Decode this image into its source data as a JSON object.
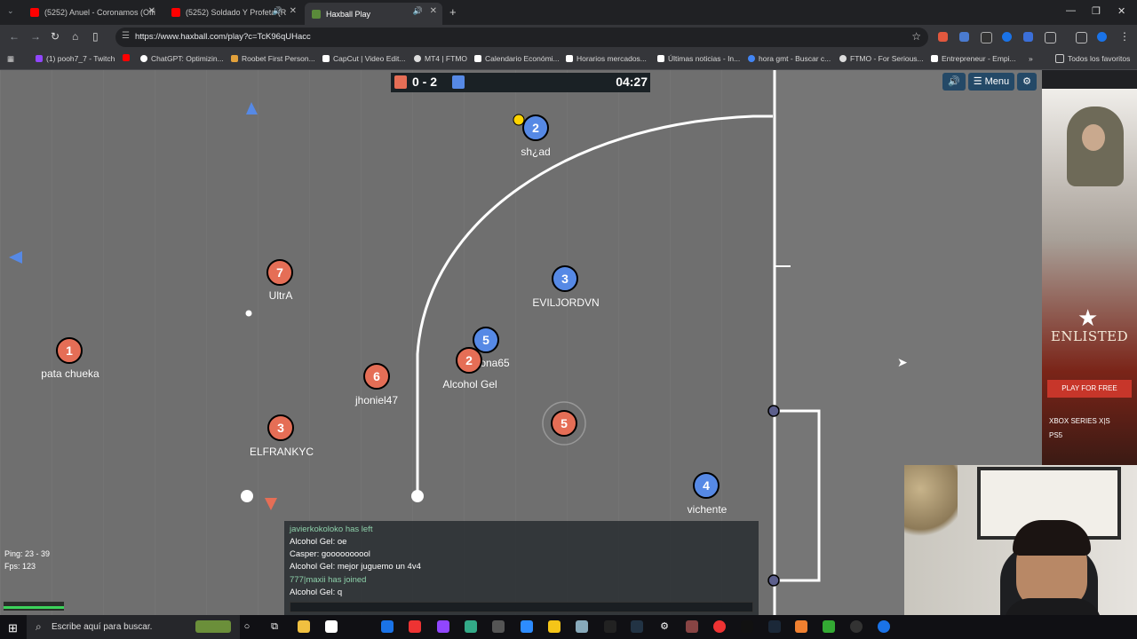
{
  "tabs": [
    {
      "title": "(5252) Anuel - Coronamos (Offi",
      "color": "#ff0000"
    },
    {
      "title": "(5252) Soldado Y Profeta (R",
      "color": "#ff0000"
    },
    {
      "title": "Haxball Play",
      "color": "#5a8a3a"
    }
  ],
  "omnibox": {
    "url": "https://www.haxball.com/play?c=TcK96qUHacc"
  },
  "bookmarks": [
    {
      "label": "(1) pooh7_7 - Twitch",
      "color": "#9146ff"
    },
    {
      "label": "",
      "color": "#ff0000"
    },
    {
      "label": "ChatGPT: Optimizin...",
      "color": "#ffffff"
    },
    {
      "label": "Roobet First Person...",
      "color": "#e2a13b"
    },
    {
      "label": "CapCut | Video Edit...",
      "color": "#ffffff"
    },
    {
      "label": "MT4 | FTMO",
      "color": "#dddddd"
    },
    {
      "label": "Calendario Económi...",
      "color": "#ffffff"
    },
    {
      "label": "Horarios mercados...",
      "color": "#ffffff"
    },
    {
      "label": "Últimas noticias - In...",
      "color": "#ffffff"
    },
    {
      "label": "hora gmt - Buscar c...",
      "color": "#4285f4"
    },
    {
      "label": "FTMO - For Serious...",
      "color": "#dddddd"
    },
    {
      "label": "Entrepreneur - Empi...",
      "color": "#ffffff"
    },
    {
      "label": "Todos los favoritos",
      "color": "#ffcc44"
    }
  ],
  "scoreboard": {
    "score": "0 - 2",
    "time": "04:27",
    "red_color": "#e56e56",
    "blue_color": "#5689e5"
  },
  "game_buttons": {
    "sound": "🔊",
    "menu": "☰ Menu",
    "settings": "⚙"
  },
  "players": [
    {
      "team": "blue",
      "number": "2",
      "name": "sh¿ad"
    },
    {
      "team": "blue",
      "number": "3",
      "name": "EVILJORDVN"
    },
    {
      "team": "blue",
      "number": "5",
      "name": "ona65"
    },
    {
      "team": "blue",
      "number": "4",
      "name": "vichente"
    },
    {
      "team": "red",
      "number": "7",
      "name": "UltrA"
    },
    {
      "team": "red",
      "number": "1",
      "name": "pata chueka"
    },
    {
      "team": "red",
      "number": "6",
      "name": "jhoniel47"
    },
    {
      "team": "red",
      "number": "2",
      "name": "Alcohol Gel"
    },
    {
      "team": "red",
      "number": "3",
      "name": "ELFRANKYC"
    },
    {
      "team": "red",
      "number": "5",
      "name": ""
    }
  ],
  "chat": {
    "lines": [
      {
        "text": "javierkokoloko has left",
        "system": true
      },
      {
        "text": "Alcohol Gel: oe",
        "system": false
      },
      {
        "text": "Casper: goooooooool",
        "system": false
      },
      {
        "text": "Alcohol Gel: mejor juguemo un 4v4",
        "system": false
      },
      {
        "text": "777|maxii has joined",
        "system": true
      },
      {
        "text": "Alcohol Gel: q",
        "system": false
      }
    ]
  },
  "stats": {
    "ping": "Ping: 23 - 39",
    "fps": "Fps: 123"
  },
  "ad": {
    "title": "ENLISTED",
    "button": "PLAY FOR FREE",
    "platform1": "XBOX SERIES X|S",
    "platform2": "PS5"
  },
  "taskbar": {
    "search_placeholder": "Escribe aquí para buscar."
  }
}
